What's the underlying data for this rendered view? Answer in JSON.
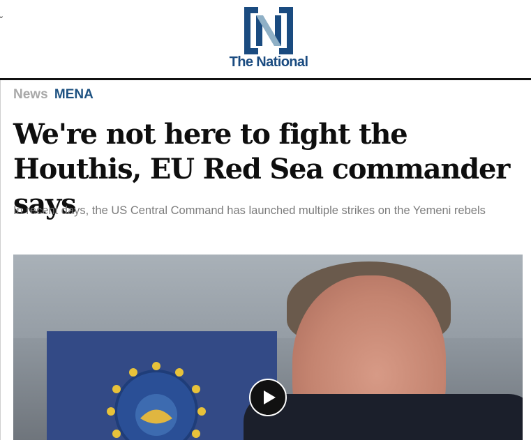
{
  "header": {
    "menu_icon": "chevron-down-icon",
    "logo_text": "The National",
    "logo_icon": "the-national-n-logo",
    "brand_color": "#1a4b80"
  },
  "breadcrumb": {
    "section": "News",
    "subsection": "MENA",
    "section_color": "#a8a8a8",
    "subsection_color": "#1d5181"
  },
  "article": {
    "headline": "We're not here to fight the Houthis, EU Red Sea commander says",
    "subtitle": "In recent days, the US Central Command has launched multiple strikes on the Yemeni rebels"
  },
  "media": {
    "image_icon": "hero-photo",
    "play_icon": "play-icon"
  }
}
